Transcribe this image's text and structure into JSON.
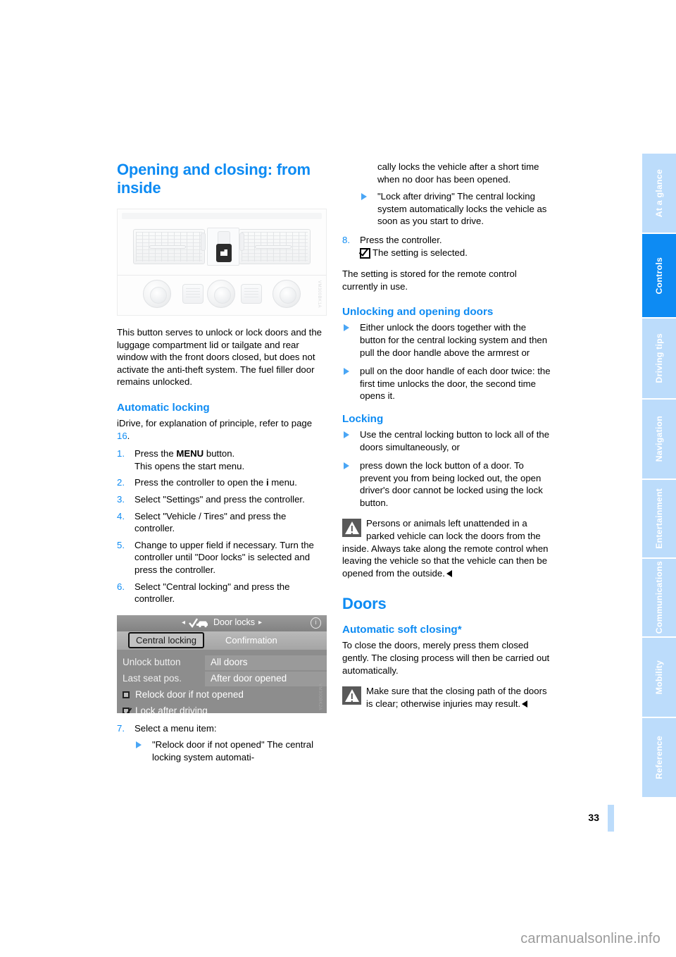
{
  "page": {
    "number": "33",
    "watermark": "carmanualsonline.info"
  },
  "sidebar": {
    "tabs": [
      {
        "label": "At a glance",
        "active": false
      },
      {
        "label": "Controls",
        "active": true
      },
      {
        "label": "Driving tips",
        "active": false
      },
      {
        "label": "Navigation",
        "active": false
      },
      {
        "label": "Entertainment",
        "active": false
      },
      {
        "label": "Communications",
        "active": false
      },
      {
        "label": "Mobility",
        "active": false
      },
      {
        "label": "Reference",
        "active": false
      }
    ]
  },
  "left_column": {
    "title": "Opening and closing: from inside",
    "photo": {
      "caption_code": "VM300BK1A",
      "alt": "dashboard-center-vents-with-central-locking-button"
    },
    "intro": "This button serves to unlock or lock doors and the luggage compartment lid or tailgate and rear window with the front doors closed, but does not activate the anti-theft system. The fuel filler door remains unlocked.",
    "automatic_locking": {
      "heading": "Automatic locking",
      "lead_before": "iDrive, for explanation of principle, refer to page ",
      "lead_page": "16",
      "lead_after": ".",
      "steps": [
        {
          "num": "1.",
          "text_before": "Press the ",
          "bold": "MENU",
          "text_after": " button.",
          "sub": "This opens the start menu."
        },
        {
          "num": "2.",
          "text_before": "Press the controller to open the ",
          "bold": "i",
          "text_after": " menu.",
          "sub": ""
        },
        {
          "num": "3.",
          "text_before": "Select \"Settings\" and press the controller.",
          "bold": "",
          "text_after": "",
          "sub": ""
        },
        {
          "num": "4.",
          "text_before": "Select \"Vehicle / Tires\" and press the controller.",
          "bold": "",
          "text_after": "",
          "sub": ""
        },
        {
          "num": "5.",
          "text_before": "Change to upper field if necessary. Turn the controller until \"Door locks\" is selected and press the controller.",
          "bold": "",
          "text_after": "",
          "sub": ""
        },
        {
          "num": "6.",
          "text_before": "Select \"Central locking\" and press the controller.",
          "bold": "",
          "text_after": "",
          "sub": ""
        }
      ]
    },
    "idrive_screen": {
      "title": "Door locks",
      "left_arrow": "◂",
      "right_arrow": "▸",
      "globe_icon": "i",
      "tab_active": "Central locking",
      "tab_other": "Confirmation",
      "rows": [
        {
          "label": "Unlock button",
          "value": "All doors"
        },
        {
          "label": "Last seat pos.",
          "value": "After door opened"
        }
      ],
      "checkboxes": [
        {
          "label": "Relock door if not opened",
          "checked": false
        },
        {
          "label": "Lock after driving",
          "checked": true
        }
      ],
      "caption_code": "VM300BK2A"
    },
    "step7": {
      "num": "7.",
      "text": "Select a menu item:",
      "bullet_title": "\"Relock door if not opened\"",
      "bullet_body": "The central locking system automati-"
    }
  },
  "right_column": {
    "continuation": "cally locks the vehicle after a short time when no door has been opened.",
    "bullet_lock_after_driving": {
      "title": "\"Lock after driving\"",
      "body": "The central locking system automatically locks the vehicle as soon as you start to drive."
    },
    "step8": {
      "num": "8.",
      "text": "Press the controller.",
      "sub": "The setting is selected."
    },
    "stored_note": "The setting is stored for the remote control currently in use.",
    "unlocking": {
      "heading": "Unlocking and opening doors",
      "bullets": [
        "Either unlock the doors together with the button for the central locking system and then pull the door handle above the armrest or",
        "pull on the door handle of each door twice: the first time unlocks the door, the second time opens it."
      ]
    },
    "locking": {
      "heading": "Locking",
      "bullets": [
        "Use the central locking button to lock all of the doors simultaneously, or",
        "press down the lock button of a door. To prevent you from being locked out, the open driver's door cannot be locked using the lock button."
      ],
      "warning": "Persons or animals left unattended in a parked vehicle can lock the doors from the inside. Always take along the remote control when leaving the vehicle so that the vehicle can then be opened from the outside."
    },
    "doors": {
      "heading": "Doors",
      "subheading": "Automatic soft closing*",
      "body": "To close the doors, merely press them closed gently. The closing process will then be carried out automatically.",
      "warning": "Make sure that the closing path of the doors is clear; otherwise injuries may result."
    }
  },
  "colors": {
    "accent_blue": "#0d8bf3",
    "tab_inactive": "#bcdcfb",
    "text": "#000000"
  }
}
